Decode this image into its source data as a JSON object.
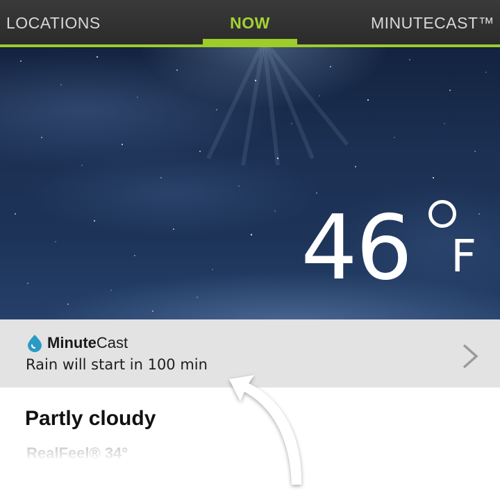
{
  "tabs": {
    "locations": "LOCATIONS",
    "now": "NOW",
    "minutecast": "MINUTECAST™"
  },
  "current": {
    "temperature": "46",
    "unit": "F",
    "condition": "Partly cloudy",
    "realfeel": "RealFeel® 34°"
  },
  "minutecast": {
    "brand_bold": "Minute",
    "brand_regular": "Cast",
    "message": "Rain will start in 100 min"
  },
  "colors": {
    "accent": "#9ccd2a",
    "tabbar": "#333333",
    "strip": "#e3e3e3",
    "logo_drop": "#2a9ac4"
  },
  "icons": {
    "minutecast_logo": "water-drop-icon",
    "chevron": "chevron-right-icon",
    "pointer": "curved-arrow-icon"
  }
}
